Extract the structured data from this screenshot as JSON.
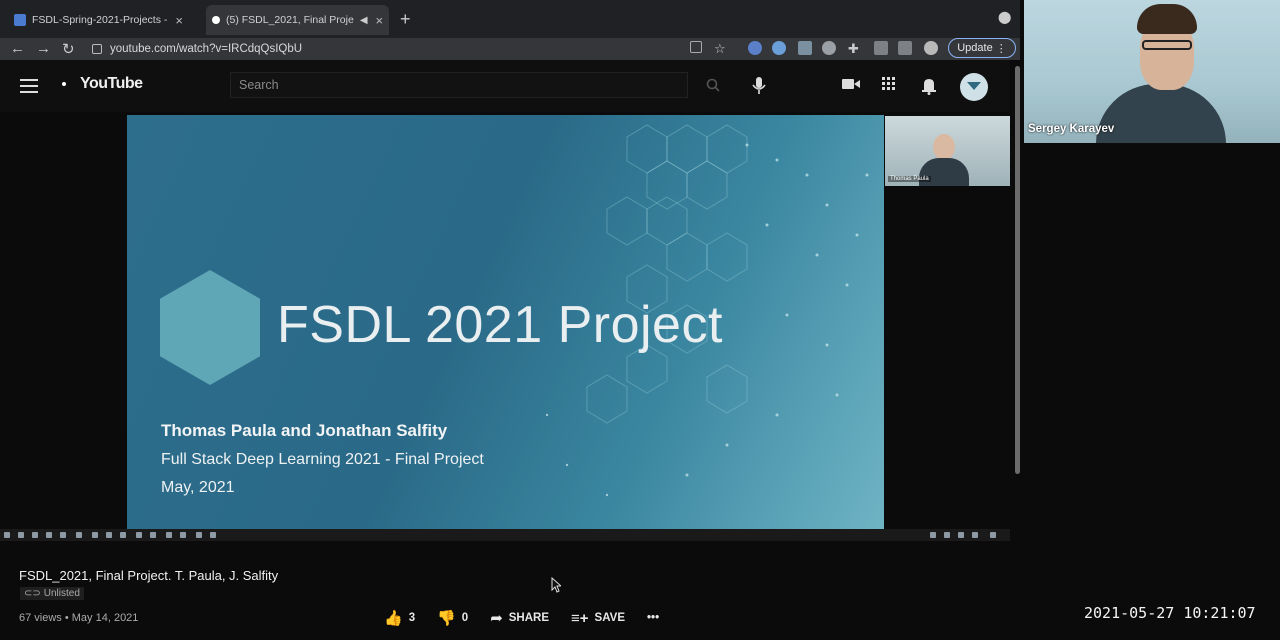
{
  "browser": {
    "tabs": [
      {
        "label": "FSDL-Spring-2021-Projects -",
        "active": false
      },
      {
        "label": "(5) FSDL_2021, Final Proje",
        "active": true
      }
    ],
    "new_tab": "+",
    "url": "youtube.com/watch?v=IRCdqQsIQbU",
    "update_label": "Update"
  },
  "youtube": {
    "logo": "YouTube",
    "search_placeholder": "Search"
  },
  "slide": {
    "title": "FSDL 2021 Project",
    "authors": "Thomas Paula and Jonathan Salfity",
    "subtitle": "Full Stack Deep Learning 2021 - Final Project",
    "date": "May, 2021"
  },
  "video_cam": {
    "name": "Thomas Paula"
  },
  "presenter": {
    "name": "Sergey Karayev"
  },
  "video": {
    "title": "FSDL_2021, Final Project. T. Paula, J. Salfity",
    "visibility": "Unlisted",
    "meta": "67 views • May 14, 2021",
    "likes": "3",
    "dislikes": "0",
    "share_label": "SHARE",
    "save_label": "SAVE",
    "more": "•••"
  },
  "timestamp": "2021-05-27 10:21:07",
  "colors": {
    "slide_bg": "#2e6e8d",
    "slide_accent": "#5fa7b7",
    "update_border": "#8ab4f8"
  }
}
